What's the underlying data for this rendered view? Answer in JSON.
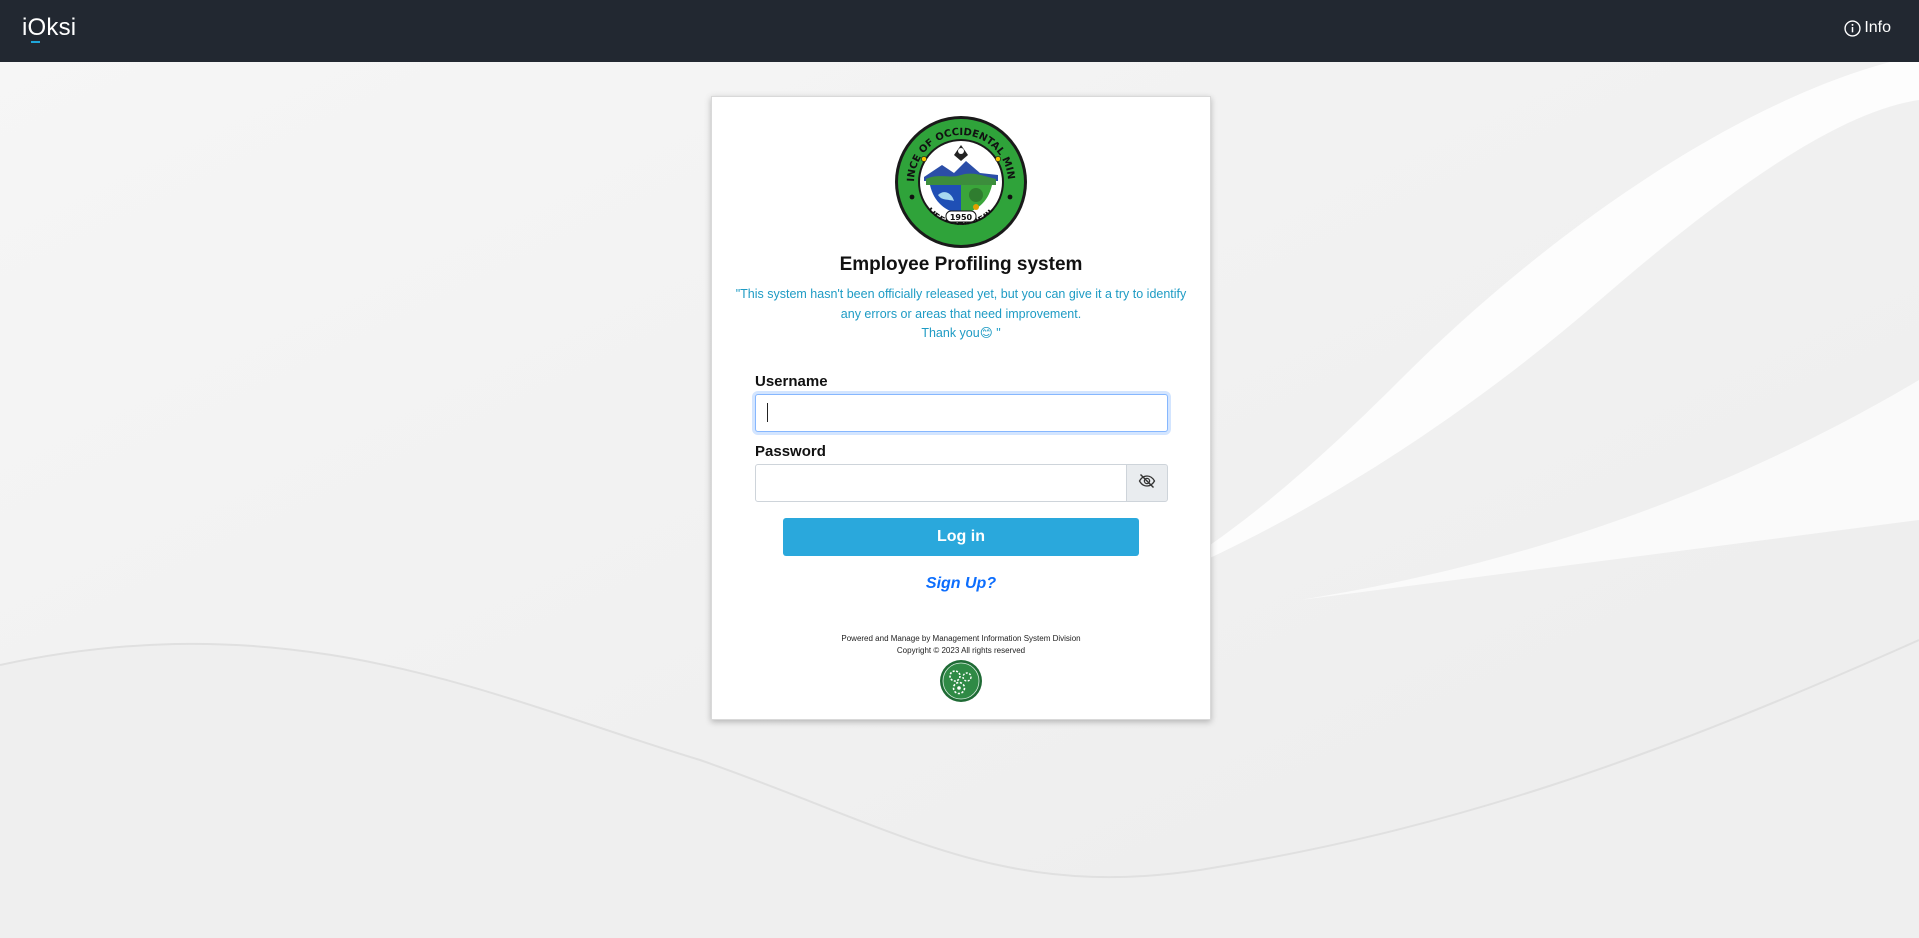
{
  "navbar": {
    "brand": "iOksi",
    "info_label": "Info"
  },
  "login_card": {
    "seal_text_top": "PROVINCE OF OCCIDENTAL MINDORO",
    "seal_text_bottom": "OFFICIAL SEAL",
    "seal_year": "1950",
    "title": "Employee Profiling system",
    "notice_line1": "\"This system hasn't been officially released yet, but you can give it a try to identify any errors or areas that need improvement.",
    "notice_line2": "Thank you😊 \"",
    "username_label": "Username",
    "username_value": "",
    "password_label": "Password",
    "password_value": "",
    "login_button": "Log in",
    "signup_link": "Sign Up?",
    "footer_line1": "Powered and Manage by Management Information System Division",
    "footer_line2": "Copyright © 2023 All rights reserved"
  },
  "colors": {
    "navbar_bg": "#222831",
    "accent": "#2aa8dc",
    "notice_text": "#1e9bc4",
    "link": "#0d6efd"
  },
  "icons": {
    "info": "info-circle-icon",
    "password_toggle": "eye-slash-icon",
    "seal": "provincial-seal",
    "footer_logo": "mis-division-logo"
  }
}
